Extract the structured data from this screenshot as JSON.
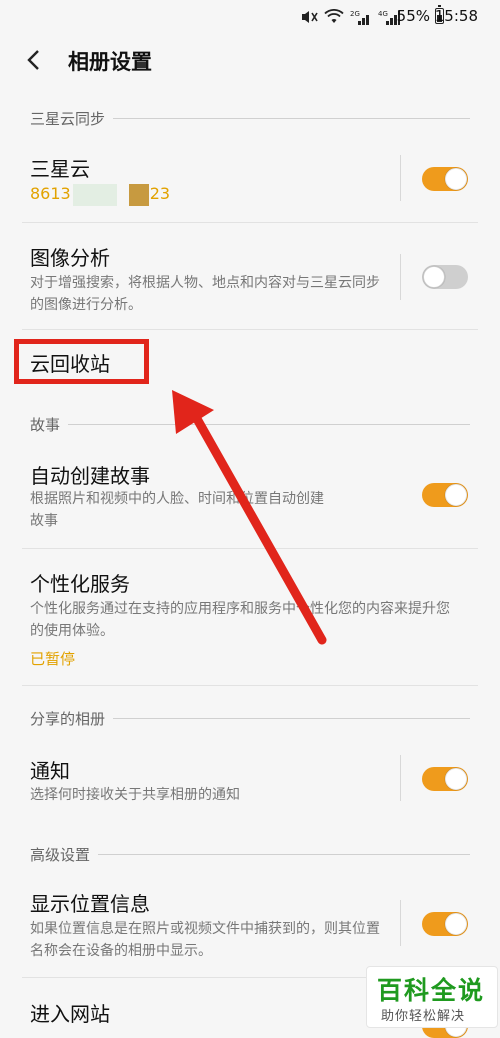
{
  "status_bar": {
    "battery_percent": "55%",
    "time": "15:58",
    "battery_level": 0.55,
    "icons": [
      "mute-icon",
      "wifi-icon",
      "signal-2g-icon",
      "signal-4g-icon",
      "battery-icon"
    ]
  },
  "header": {
    "back_icon": "chevron-left-icon",
    "title": "相册设置"
  },
  "sections": {
    "samsung_sync": {
      "header": "三星云同步"
    },
    "stories": {
      "header": "故事"
    },
    "shared": {
      "header": "分享的相册"
    },
    "advanced": {
      "header": "高级设置"
    }
  },
  "rows": {
    "samsung_cloud": {
      "title": "三星云",
      "account_prefix": "8613",
      "account_suffix": "23",
      "enabled": true
    },
    "image_analysis": {
      "title": "图像分析",
      "description": "对于增强搜索，将根据人物、地点和内容对与三星云同步的图像进行分析。",
      "enabled": false
    },
    "cloud_trash": {
      "title": "云回收站"
    },
    "auto_stories": {
      "title": "自动创建故事",
      "description": "根据照片和视频中的人脸、时间和位置自动创建故事",
      "enabled": true
    },
    "personalization": {
      "title": "个性化服务",
      "description": "个性化服务通过在支持的应用程序和服务中个性化您的内容来提升您的使用体验。",
      "status": "已暂停"
    },
    "notifications": {
      "title": "通知",
      "description": "选择何时接收关于共享相册的通知",
      "enabled": true
    },
    "location_info": {
      "title": "显示位置信息",
      "description": "如果位置信息是在照片或视频文件中捕获到的，则其位置名称会在设备的相册中显示。",
      "enabled": true
    },
    "website": {
      "title": "进入网站",
      "enabled": true
    }
  },
  "colors": {
    "accent": "#ef9b1c",
    "annotation_red": "#e1251b",
    "background": "#f6f6f6"
  },
  "watermark": {
    "title": "百科全说",
    "subtitle": "助你轻松解决"
  }
}
